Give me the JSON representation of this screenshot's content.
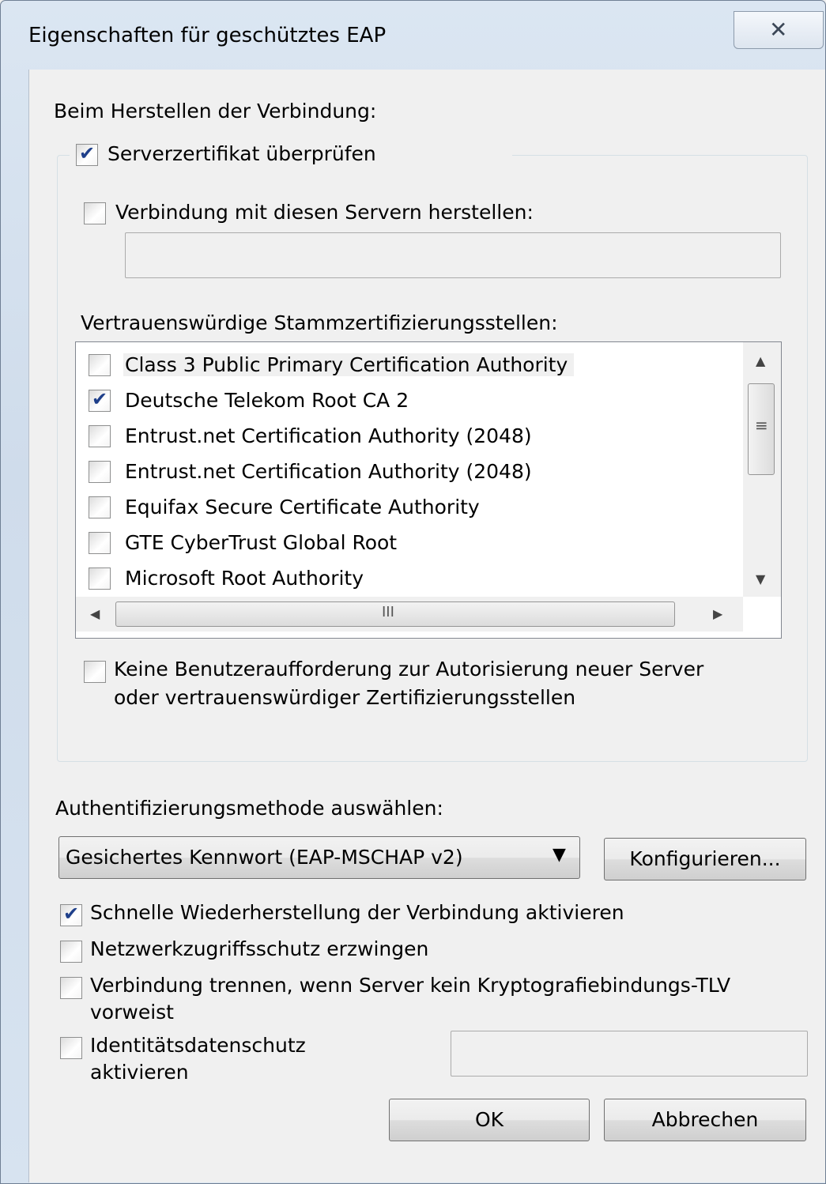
{
  "window": {
    "title": "Eigenschaften für geschütztes EAP",
    "close_glyph": "✕"
  },
  "connect_label": "Beim Herstellen der Verbindung:",
  "verify_cert": {
    "label": "Serverzertifikat überprüfen",
    "checked": true
  },
  "connect_servers": {
    "label": "Verbindung mit diesen Servern herstellen:",
    "checked": false,
    "value": ""
  },
  "trusted_ca": {
    "label": "Vertrauenswürdige Stammzertifizierungsstellen:",
    "items": [
      {
        "label": "Class 3 Public Primary Certification Authority",
        "checked": false
      },
      {
        "label": "Deutsche Telekom Root CA 2",
        "checked": true
      },
      {
        "label": "Entrust.net Certification Authority (2048)",
        "checked": false
      },
      {
        "label": "Entrust.net Certification Authority (2048)",
        "checked": false
      },
      {
        "label": "Equifax Secure Certificate Authority",
        "checked": false
      },
      {
        "label": "GTE CyberTrust Global Root",
        "checked": false
      },
      {
        "label": "Microsoft Root Authority",
        "checked": false
      }
    ]
  },
  "no_prompt": {
    "line1": "Keine Benutzeraufforderung zur Autorisierung neuer Server",
    "line2": "oder vertrauenswürdiger Zertifizierungsstellen",
    "checked": false
  },
  "auth_method": {
    "label": "Authentifizierungsmethode auswählen:",
    "selected": "Gesichertes Kennwort (EAP-MSCHAP v2)",
    "configure_label": "Konfigurieren..."
  },
  "options": {
    "fast_reconnect": {
      "label": "Schnelle Wiederherstellung der Verbindung aktivieren",
      "checked": true
    },
    "nap": {
      "label": "Netzwerkzugriffsschutz erzwingen",
      "checked": false
    },
    "disconnect_tlv": {
      "line1": "Verbindung trennen, wenn Server kein Kryptografiebindungs-TLV",
      "line2": "vorweist",
      "checked": false
    },
    "identity_privacy": {
      "line1": "Identitätsdatenschutz",
      "line2": "aktivieren",
      "checked": false,
      "value": ""
    }
  },
  "buttons": {
    "ok": "OK",
    "cancel": "Abbrechen"
  },
  "scroll_glyphs": {
    "up": "▲",
    "down": "▼",
    "left": "◀",
    "right": "▶",
    "grip_v": "≡",
    "grip_h": "III",
    "combo_arrow": "▼"
  }
}
